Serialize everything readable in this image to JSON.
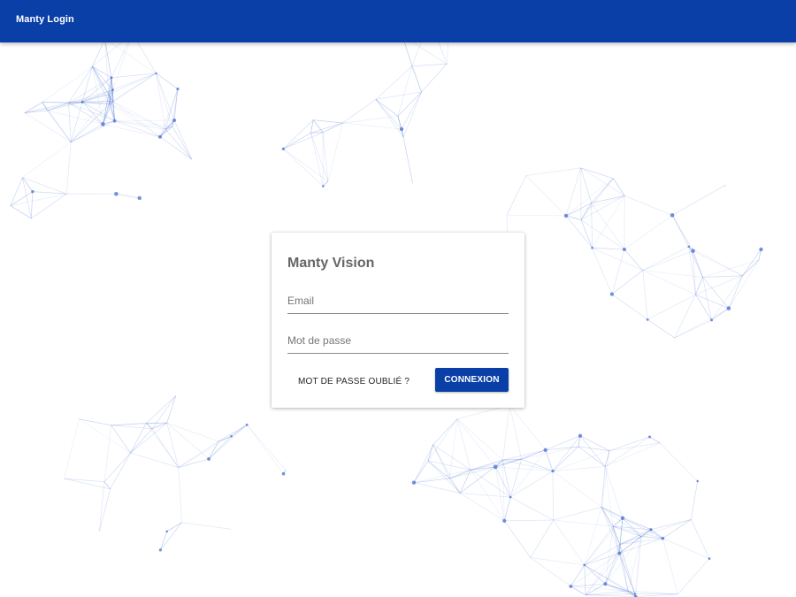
{
  "header": {
    "title": "Manty Login"
  },
  "login": {
    "title": "Manty Vision",
    "email_placeholder": "Email",
    "password_placeholder": "Mot de passe",
    "forgot_label": "MOT DE PASSE OUBLIÉ ?",
    "submit_label": "CONNEXION"
  },
  "colors": {
    "primary": "#0a3fa8",
    "network_line": "#5b7fd6",
    "network_node": "#4a6fd0"
  }
}
